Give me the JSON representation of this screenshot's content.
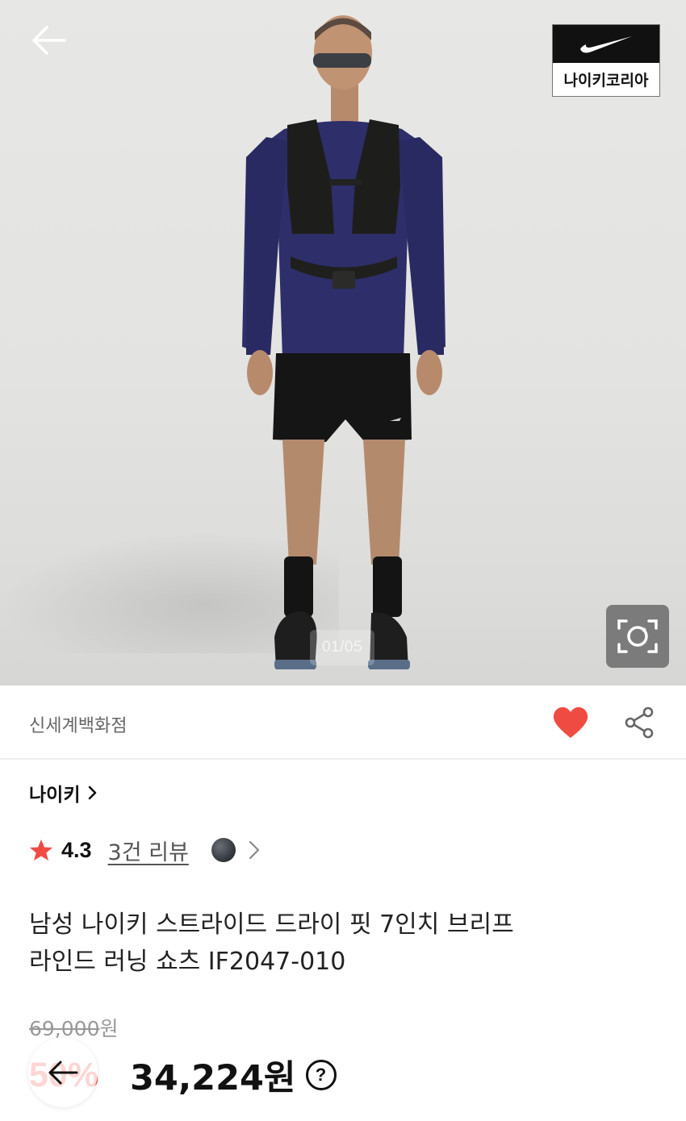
{
  "hero": {
    "page_counter": "01/05",
    "brand_badge_text": "나이키코리아"
  },
  "seller": {
    "name": "신세계백화점"
  },
  "brand": {
    "name": "나이키",
    "chevron": "›"
  },
  "rating": {
    "score": "4.3",
    "review_link": "3건 리뷰"
  },
  "product": {
    "title_line1": "남성 나이키 스트라이드 드라이 핏 7인치 브리프",
    "title_line2": "라인드 러닝 쇼츠 IF2047-010"
  },
  "price": {
    "original": "69,000",
    "original_unit": "원",
    "discount": "50%",
    "sale": "34,224원",
    "help_glyph": "?"
  },
  "colors": {
    "favorite": "#f04b43",
    "discount": "#f04b43"
  },
  "icons": [
    "arrow-left-icon",
    "nike-swoosh-icon",
    "lens-search-icon",
    "heart-icon",
    "share-icon",
    "star-icon",
    "chevron-right-icon",
    "help-icon"
  ]
}
